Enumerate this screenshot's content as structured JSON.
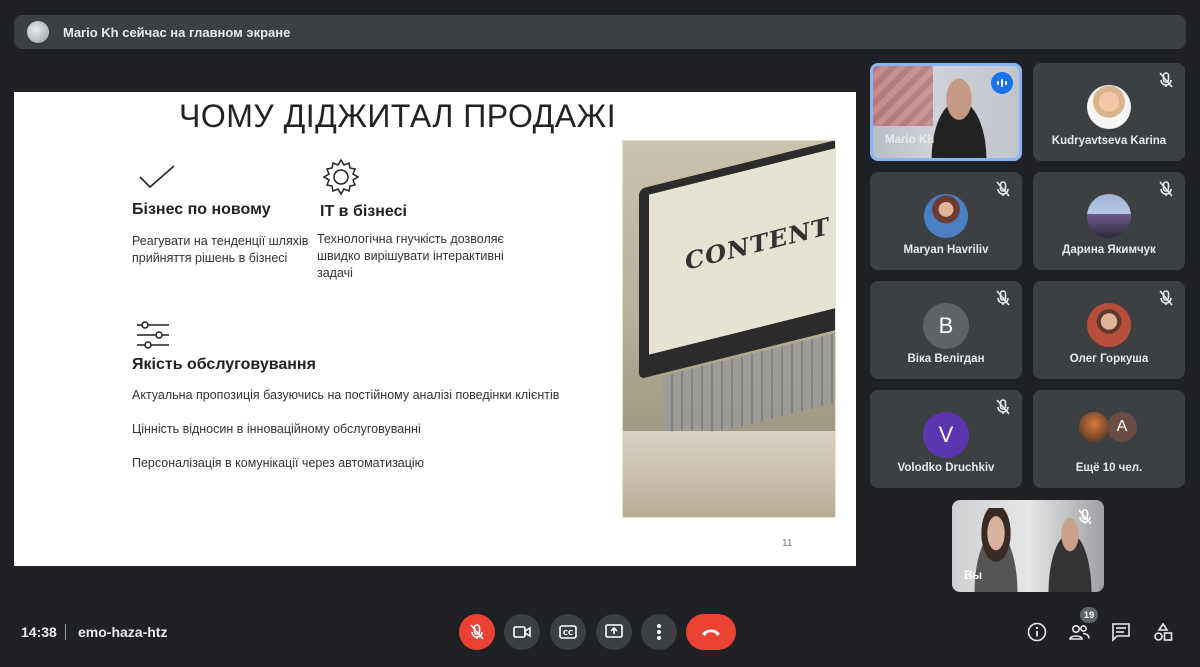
{
  "banner": {
    "text": "Mario Kh сейчас на главном экране"
  },
  "slide": {
    "title": "ЧОМУ ДІДЖИТАЛ ПРОДАЖІ",
    "features": [
      {
        "heading": "Бізнес по новому",
        "desc": [
          "Реагувати на тенденції шляхів",
          "прийняття рішень в бізнесі"
        ],
        "icon": "check-icon"
      },
      {
        "heading": "ІТ в бізнесі",
        "desc": [
          "Технологічна гнучкість  дозволяє",
          "швидко вирішувати інтерактивні",
          "задачі"
        ],
        "icon": "gear-icon"
      },
      {
        "heading": "Якість обслуговування",
        "icon": "sliders-icon"
      }
    ],
    "bullets": [
      "Актуальна пропозиція базуючись на постійному аналізі поведінки клієнтів",
      "Цінність відносин в інноваційному обслуговуванні",
      "Персоналізація в комунікації через автоматизацію"
    ],
    "photo_text": "CONTENT",
    "page_number": "11"
  },
  "participants": [
    {
      "name": "Mario Kh",
      "speaking": true
    },
    {
      "name": "Kudryavtseva Karina",
      "muted": true
    },
    {
      "name": "Maryan Havriliv",
      "muted": true
    },
    {
      "name": "Дарина Якимчук",
      "muted": true
    },
    {
      "name": "Віка Велігдан",
      "muted": true,
      "initial": "B",
      "color": "#5f6368"
    },
    {
      "name": "Олег Горкуша",
      "muted": true
    },
    {
      "name": "Volodko Druchkiv",
      "muted": true,
      "initial": "V",
      "color": "#5e35b1"
    },
    {
      "name": "Ещё 10 чел.",
      "initial": "A"
    }
  ],
  "self": {
    "name": "Вы",
    "muted": true
  },
  "bottom": {
    "time": "14:38",
    "meeting_code": "emo-haza-htz",
    "participant_count": "19"
  },
  "colors": {
    "hangup": "#ea4335",
    "active_border": "#8ab4f8",
    "speaking": "#1a73e8"
  }
}
